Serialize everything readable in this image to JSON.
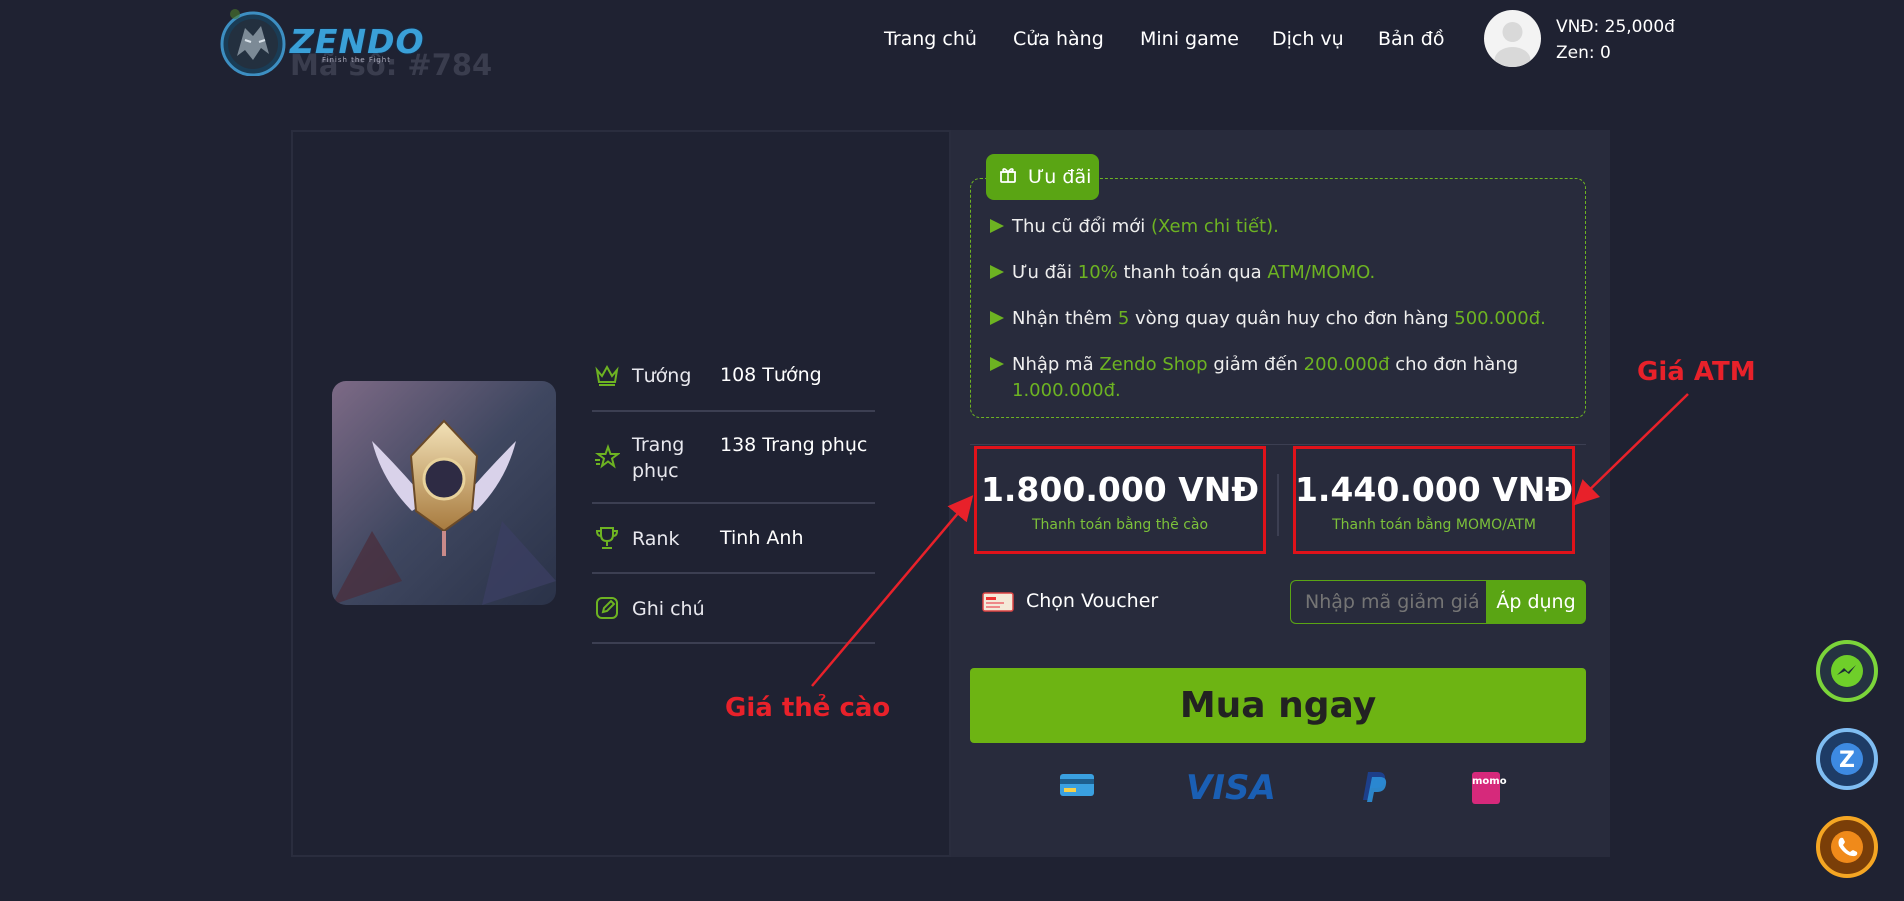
{
  "header": {
    "logo_text": "ZENDO",
    "logo_sub": "Finish the Fight",
    "ghost_text": "Mã số: #784",
    "nav": [
      "Trang chủ",
      "Cửa hàng",
      "Mini game",
      "Dịch vụ",
      "Bản đồ"
    ],
    "account": {
      "vnd": "VNĐ: 25,000đ",
      "zen": "Zen: 0"
    }
  },
  "stats": [
    {
      "icon": "crown-icon",
      "label": "Tướng",
      "value": "108 Tướng"
    },
    {
      "icon": "sparkle-star-icon",
      "label": "Trang phục",
      "value": "138 Trang phục"
    },
    {
      "icon": "trophy-icon",
      "label": "Rank",
      "value": "Tinh Anh"
    },
    {
      "icon": "edit-icon",
      "label": "Ghi chú",
      "value": ""
    }
  ],
  "offers": {
    "tag": "Ưu đãi",
    "l1a": "Thu cũ đổi mới ",
    "l1b": "(Xem chi tiết).",
    "l2a": "Ưu đãi ",
    "l2b": "10%",
    "l2c": " thanh toán qua ",
    "l2d": "ATM/MOMO.",
    "l3a": "Nhận thêm ",
    "l3b": "5",
    "l3c": " vòng quay quân huy cho đơn hàng ",
    "l3d": "500.000đ.",
    "l4a": "Nhập mã ",
    "l4b": "Zendo Shop",
    "l4c": " giảm đến ",
    "l4d": "200.000đ",
    "l4e": " cho đơn hàng",
    "l4f": "1.000.000đ."
  },
  "prices": {
    "card": {
      "amount": "1.800.000 VNĐ",
      "label": "Thanh toán bằng thẻ cào"
    },
    "atm": {
      "amount": "1.440.000 VNĐ",
      "label": "Thanh toán bằng MOMO/ATM"
    }
  },
  "voucher": {
    "label": "Chọn Voucher",
    "placeholder": "Nhập mã giảm giá",
    "apply": "Áp dụng"
  },
  "buy_label": "Mua ngay",
  "payment_methods": [
    "card-icon",
    "VISA",
    "paypal-icon",
    "momo"
  ],
  "annotations": {
    "atm": "Giá ATM",
    "card": "Giá thẻ cào"
  },
  "colors": {
    "accent": "#6db413",
    "bg": "#1f2232",
    "panel": "#282b3c",
    "annotation": "#e8212a"
  }
}
